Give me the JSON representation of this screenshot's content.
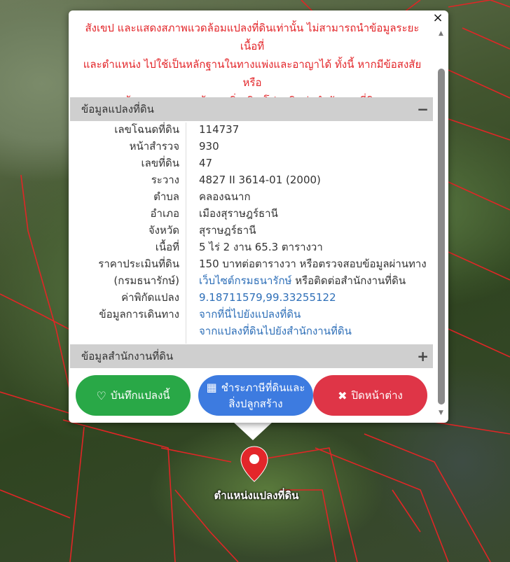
{
  "popup": {
    "close_label": "×",
    "warning_lines": [
      "สังเขป และแสดงสภาพแวดล้อมแปลงที่ดินเท่านั้น ไม่สามารถนำข้อมูลระยะ เนื้อที่",
      "และตำแหน่ง ไปใช้เป็นหลักฐานในทางแพ่งและอาญาได้ ทั้งนี้ หากมีข้อสงสัยหรือ",
      "ต้องการสอบถามข้อมูลเพิ่มเติม โปรดติดต่อสำนักงานที่ดิน"
    ],
    "parcel_section": {
      "title": "ข้อมูลแปลงที่ดิน",
      "toggle": "−"
    },
    "fields": [
      {
        "label": "เลขโฉนดที่ดิน",
        "value": "114737"
      },
      {
        "label": "หน้าสำรวจ",
        "value": "930"
      },
      {
        "label": "เลขที่ดิน",
        "value": "47"
      },
      {
        "label": "ระวาง",
        "value": "4827 II 3614-01 (2000)"
      },
      {
        "label": "ตำบล",
        "value": "คลองฉนาก"
      },
      {
        "label": "อำเภอ",
        "value": "เมืองสุราษฎร์ธานี"
      },
      {
        "label": "จังหวัด",
        "value": "สุราษฎร์ธานี"
      },
      {
        "label": "เนื้อที่",
        "value": "5 ไร่ 2 งาน 65.3 ตารางวา"
      }
    ],
    "price": {
      "label": "ราคาประเมินที่ดิน",
      "label2": "(กรมธนารักษ์)",
      "value": "150 บาทต่อตารางวา หรือตรวจสอบข้อมูลผ่านทาง",
      "link": "เว็บไซต์กรมธนารักษ์",
      "value_suffix": " หรือติดต่อสำนักงานที่ดิน"
    },
    "coords": {
      "label": "ค่าพิกัดแปลง",
      "value": "9.18711579,99.33255122"
    },
    "travel": {
      "label": "ข้อมูลการเดินทาง",
      "link1": "จากที่นี่ไปยังแปลงที่ดิน",
      "link2": "จากแปลงที่ดินไปยังสำนักงานที่ดิน"
    },
    "office_section": {
      "title": "ข้อมูลสำนักงานที่ดิน",
      "toggle": "+"
    },
    "buttons": {
      "save": "บันทึกแปลงนี้",
      "pay_line1": "ชำระภาษีที่ดินและ",
      "pay_line2": "สิ่งปลูกสร้าง",
      "close": "ปิดหน้าต่าง"
    }
  },
  "map": {
    "marker_label": "ตำแหน่งแปลงที่ดิน"
  },
  "colors": {
    "warning": "#e3262a",
    "green": "#29a847",
    "blue": "#3d7be0",
    "red": "#df3547",
    "link": "#2e6fb8"
  }
}
